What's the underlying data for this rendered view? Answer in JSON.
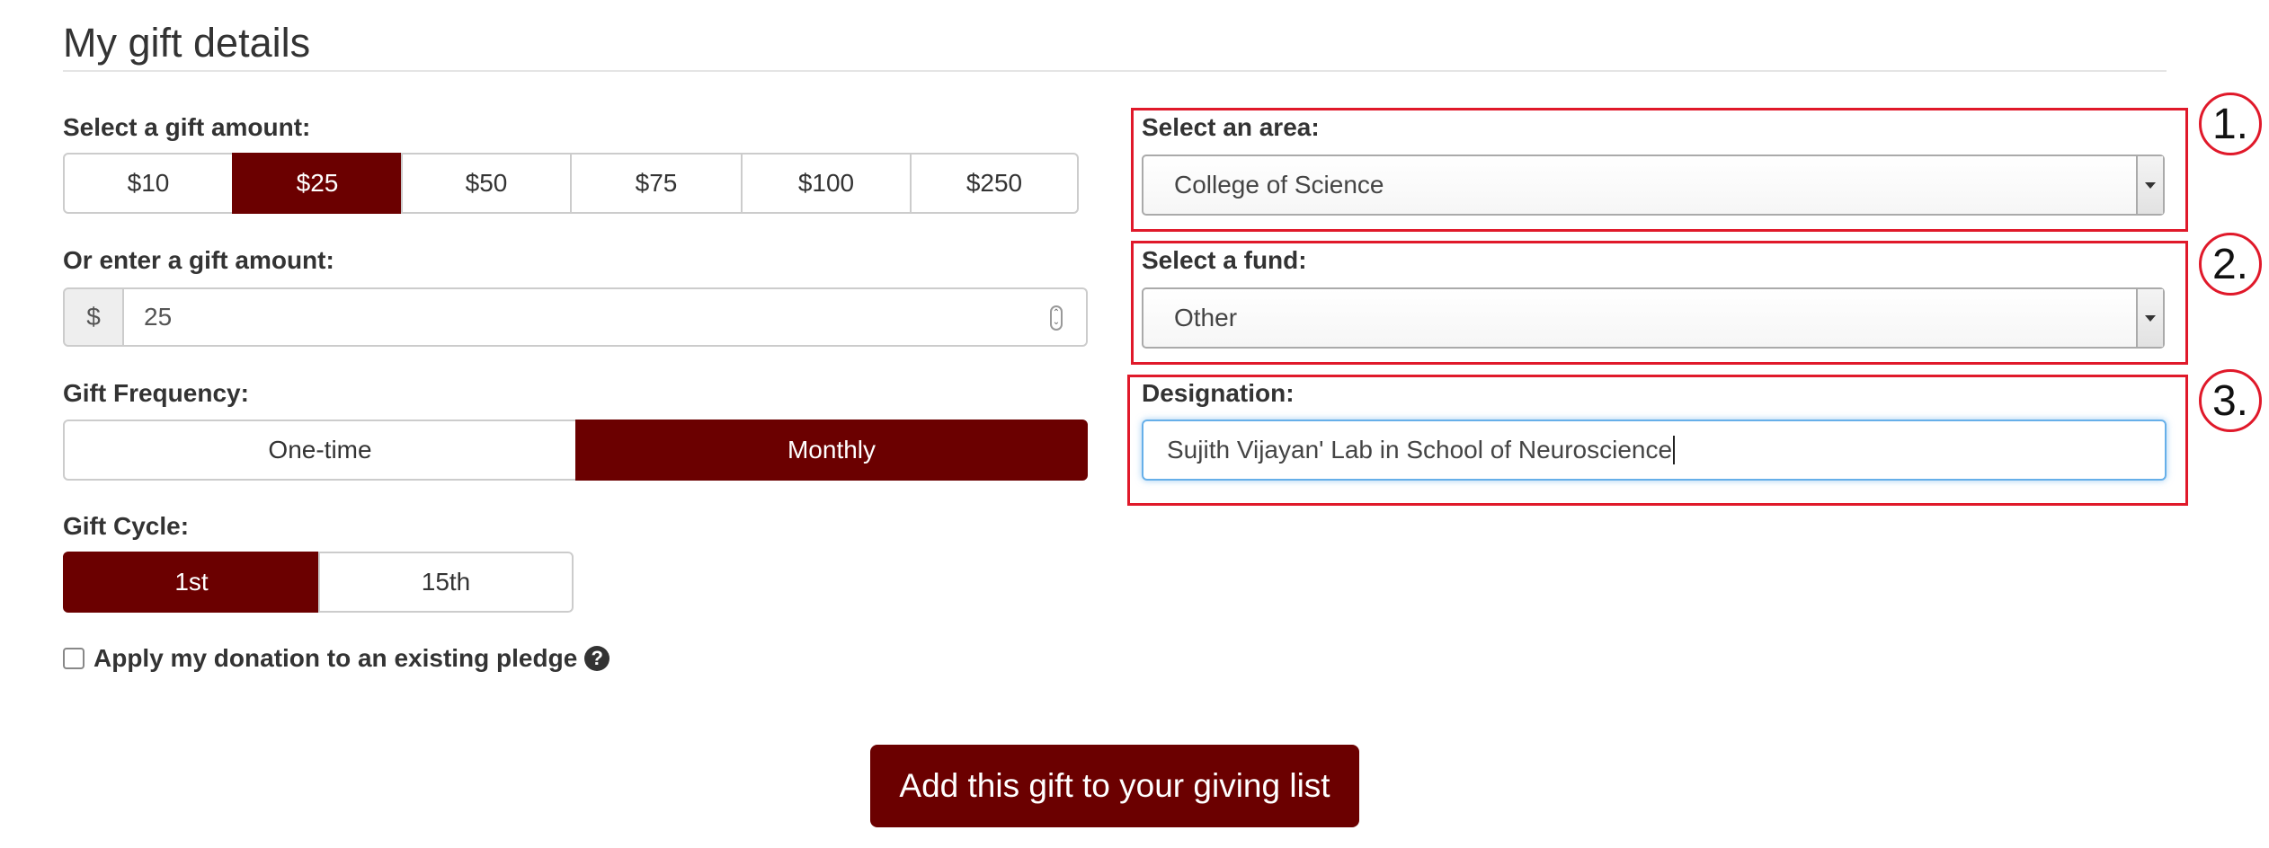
{
  "section": {
    "title": "My gift details"
  },
  "amount": {
    "label": "Select a gift amount:",
    "options": [
      "$10",
      "$25",
      "$50",
      "$75",
      "$100",
      "$250"
    ],
    "selected": "$25"
  },
  "custom_amount": {
    "label": "Or enter a gift amount:",
    "currency_symbol": "$",
    "value": "25"
  },
  "frequency": {
    "label": "Gift Frequency:",
    "options": [
      "One-time",
      "Monthly"
    ],
    "selected": "Monthly"
  },
  "cycle": {
    "label": "Gift Cycle:",
    "options": [
      "1st",
      "15th"
    ],
    "selected": "1st"
  },
  "pledge": {
    "label": "Apply my donation to an existing pledge",
    "checked": false,
    "help_icon": "question-circle-icon"
  },
  "area": {
    "label": "Select an area:",
    "value": "College of Science"
  },
  "fund": {
    "label": "Select a fund:",
    "value": "Other"
  },
  "designation": {
    "label": "Designation:",
    "value": "Sujith Vijayan' Lab in School of Neuroscience"
  },
  "annotations": [
    "1.",
    "2.",
    "3."
  ],
  "submit": {
    "label": "Add this gift to your giving list"
  },
  "colors": {
    "accent": "#6b0000",
    "annotation_red": "#e0192a",
    "focus_blue": "#66afe9"
  }
}
